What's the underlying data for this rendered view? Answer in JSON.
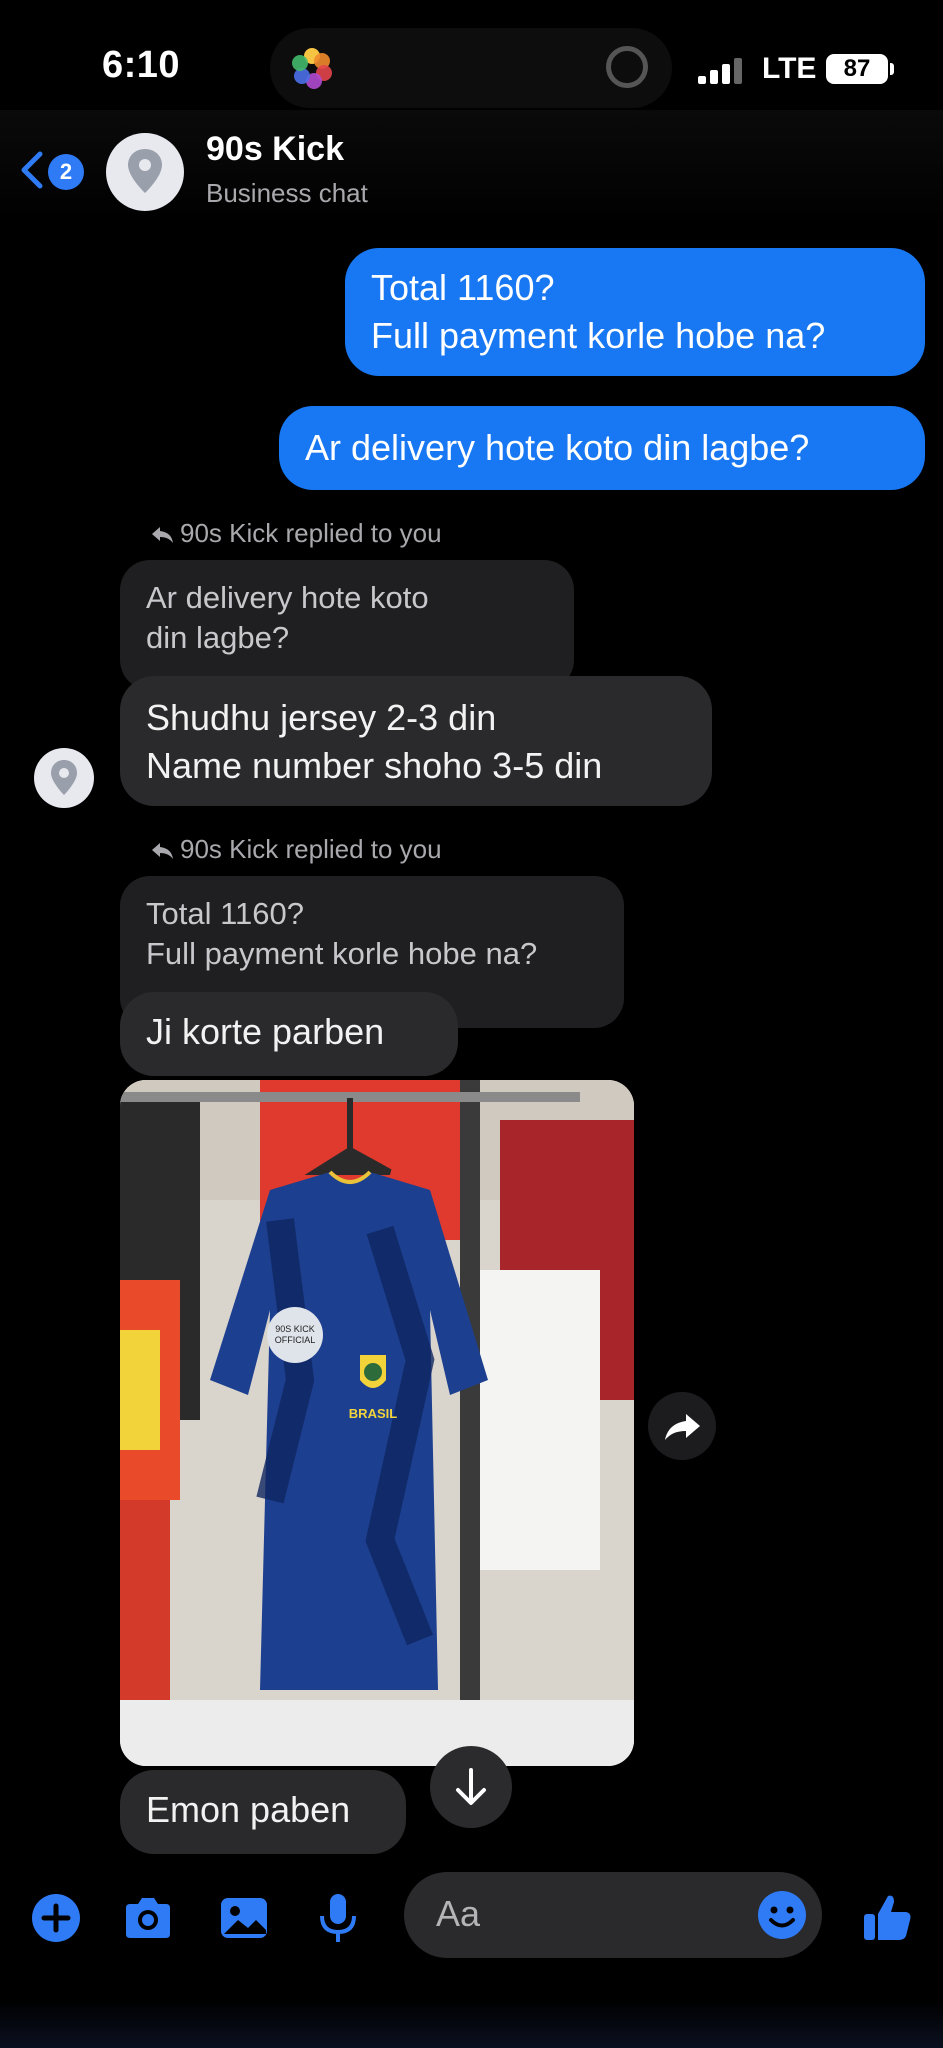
{
  "status_bar": {
    "time": "6:10",
    "network": "LTE",
    "battery": "87"
  },
  "header": {
    "back_count": "2",
    "title": "90s Kick",
    "subtitle": "Business chat"
  },
  "messages": {
    "out1": [
      "Total 1160?",
      "Full payment korle hobe na?"
    ],
    "out2": "Ar delivery hote koto din lagbe?",
    "reply1_note": "90s Kick replied to you",
    "reply1_quote": [
      "Ar delivery hote koto",
      "din lagbe?"
    ],
    "reply1_text": [
      "Shudhu jersey 2-3 din",
      "Name number shoho 3-5 din"
    ],
    "reply2_note": "90s Kick replied to you",
    "reply2_quote": [
      "Total 1160?",
      "Full payment korle hobe na?"
    ],
    "reply2_text": "Ji korte parben",
    "photo_badge": [
      "90S KICK",
      "OFFICIAL"
    ],
    "photo_crest": "BRASIL",
    "last_text": "Emon paben"
  },
  "composer": {
    "placeholder": "Aa"
  },
  "icons": {
    "photos": "photos-app-icon",
    "back": "chevron-left-icon",
    "avatar": "location-pin-icon",
    "reply": "reply-arrow-icon",
    "share": "share-icon",
    "scroll_down": "arrow-down-icon",
    "plus": "plus-icon",
    "camera": "camera-icon",
    "gallery": "image-icon",
    "mic": "microphone-icon",
    "emoji": "emoji-icon",
    "like": "thumbs-up-icon"
  },
  "colors": {
    "accent": "#1877f2",
    "icon_blue": "#2f7bf6",
    "incoming": "#2a2a2c",
    "background": "#000000"
  }
}
